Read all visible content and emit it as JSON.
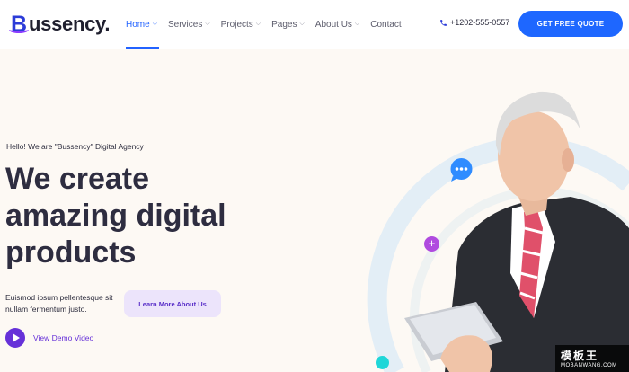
{
  "brand": {
    "name": "ussency.",
    "initial": "B",
    "accent": "#2b3bd8",
    "swoosh": "#8b3cff"
  },
  "nav": {
    "items": [
      {
        "label": "Home",
        "active": true,
        "has_dropdown": true
      },
      {
        "label": "Services",
        "active": false,
        "has_dropdown": true
      },
      {
        "label": "Projects",
        "active": false,
        "has_dropdown": true
      },
      {
        "label": "Pages",
        "active": false,
        "has_dropdown": true
      },
      {
        "label": "About Us",
        "active": false,
        "has_dropdown": true
      },
      {
        "label": "Contact",
        "active": false,
        "has_dropdown": false
      }
    ],
    "chevron": "⌵"
  },
  "header": {
    "phone": "+1202-555-0557",
    "phone_icon": "phone-icon",
    "cta_label": "GET FREE QUOTE",
    "cta_color": "#1e67ff"
  },
  "hero": {
    "greeting": "Hello! We are \"Bussency\" Digital Agency",
    "headline": [
      "We create",
      "amazing digital",
      "products"
    ],
    "description": "Euismod ipsum pellentesque sit nullam fermentum justo.",
    "learn_button": "Learn More About Us",
    "video_label": "View Demo Video",
    "play_icon": "play-icon",
    "purple": "#6631d8"
  },
  "decor": {
    "chat_icon": "chat-bubble-icon",
    "plus_icon": "plus-icon",
    "plus_glyph": "+"
  },
  "watermark": {
    "top": "模板王",
    "bottom": "MOBANWANG.COM"
  }
}
